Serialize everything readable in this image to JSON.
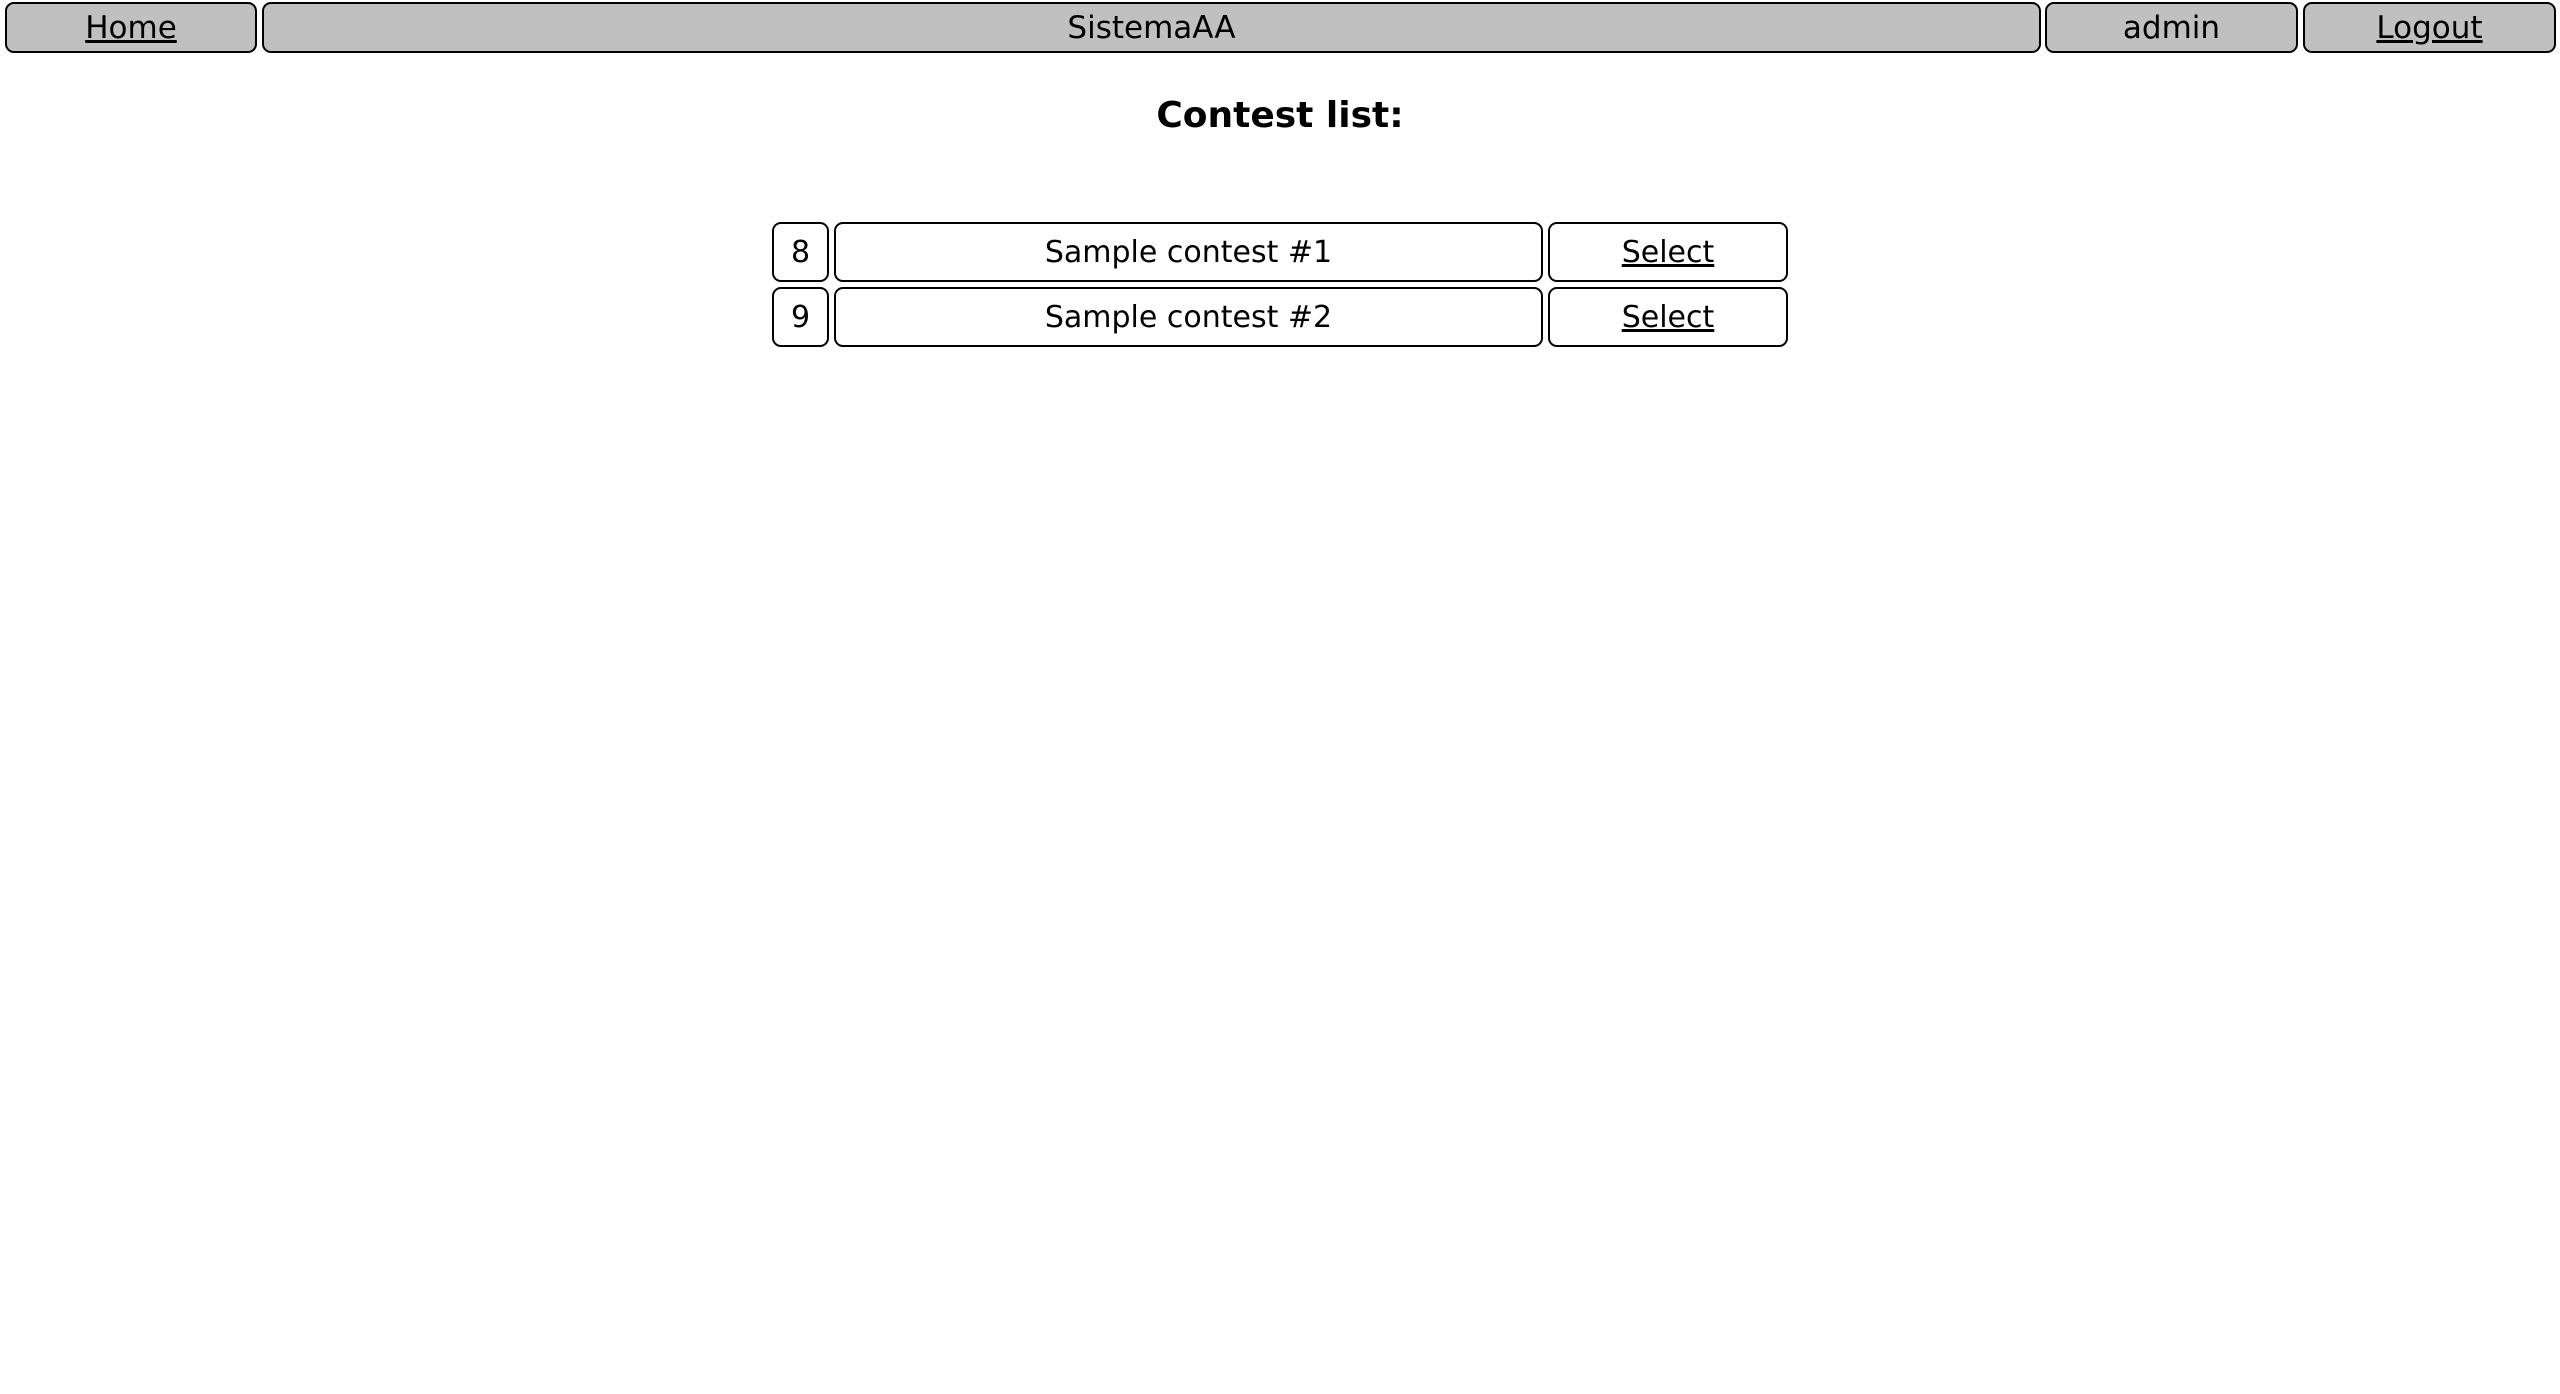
{
  "nav": {
    "home": "Home",
    "title": "SistemaAA",
    "user": "admin",
    "logout": "Logout"
  },
  "heading": "Contest list:",
  "contests": [
    {
      "id": "8",
      "name": "Sample contest #1",
      "action": "Select"
    },
    {
      "id": "9",
      "name": "Sample contest #2",
      "action": "Select"
    }
  ]
}
